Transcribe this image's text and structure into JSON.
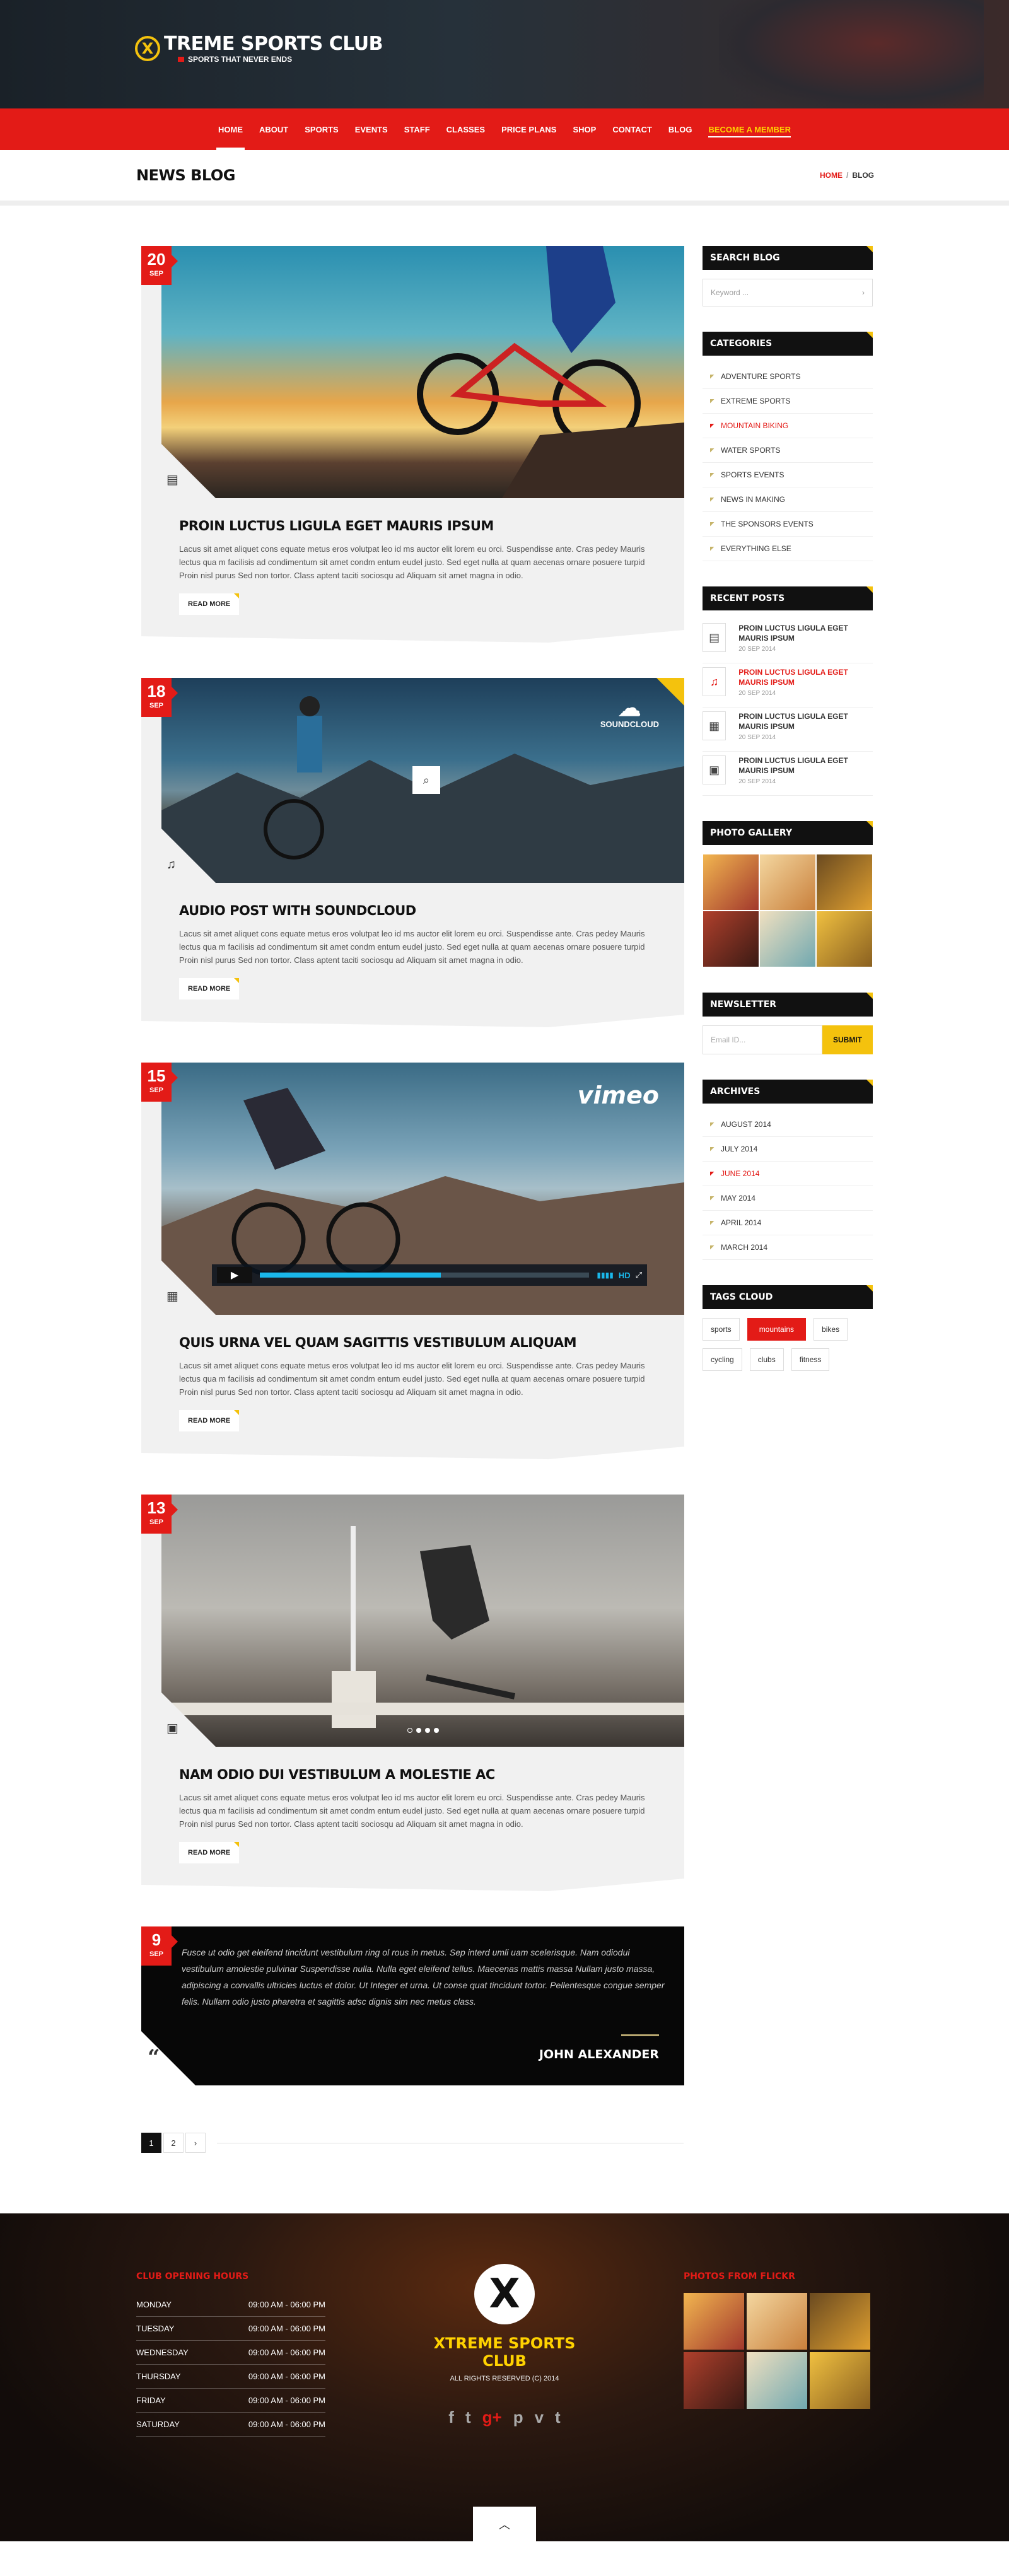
{
  "header": {
    "logo_mark": "X",
    "title": "TREME SPORTS CLUB",
    "tagline": "SPORTS THAT NEVER ENDS"
  },
  "nav": [
    "HOME",
    "ABOUT",
    "SPORTS",
    "EVENTS",
    "STAFF",
    "CLASSES",
    "PRICE PLANS",
    "SHOP",
    "CONTACT",
    "BLOG",
    "BECOME A MEMBER"
  ],
  "page": {
    "title": "NEWS BLOG",
    "breadcrumb": {
      "home": "HOME",
      "sep": "/",
      "current": "BLOG"
    }
  },
  "posts": [
    {
      "day": "20",
      "month": "SEP",
      "title": "PROIN LUCTUS LIGULA EGET MAURIS IPSUM",
      "text": "Lacus sit amet aliquet cons equate metus eros volutpat leo id ms auctor elit lorem eu orci. Suspendisse ante. Cras pedey Mauris lectus qua m facilisis ad condimentum sit amet condm entum eudel justo. Sed eget nulla at quam aecenas ornare posuere turpid Proin nisl purus Sed non tortor. Class aptent taciti sociosqu ad  Aliquam sit amet magna in odio.",
      "more": "READ MORE",
      "icon": "document-icon"
    },
    {
      "day": "18",
      "month": "SEP",
      "title": "AUDIO POST WITH SOUNDCLOUD",
      "text": "Lacus sit amet aliquet cons equate metus eros volutpat leo id ms auctor elit lorem eu orci. Suspendisse ante. Cras pedey Mauris lectus qua m facilisis ad condimentum sit amet condm entum eudel justo. Sed eget nulla at quam aecenas ornare posuere turpid Proin nisl purus Sed non tortor. Class aptent taciti sociosqu ad  Aliquam sit amet magna in odio.",
      "more": "READ MORE",
      "icon": "music-note-icon",
      "badge": "SOUNDCLOUD"
    },
    {
      "day": "15",
      "month": "SEP",
      "title": "QUIS URNA VEL QUAM SAGITTIS VESTIBULUM ALIQUAM",
      "text": "Lacus sit amet aliquet cons equate metus eros volutpat leo id ms auctor elit lorem eu orci. Suspendisse ante. Cras pedey Mauris lectus qua m facilisis ad condimentum sit amet condm entum eudel justo. Sed eget nulla at quam aecenas ornare posuere turpid Proin nisl purus Sed non tortor. Class aptent taciti sociosqu ad  Aliquam sit amet magna in odio.",
      "more": "READ MORE",
      "icon": "film-icon",
      "badge": "vimeo",
      "hd": "HD"
    },
    {
      "day": "13",
      "month": "SEP",
      "title": "NAM ODIO DUI VESTIBULUM A MOLESTIE AC",
      "text": "Lacus sit amet aliquet cons equate metus eros volutpat leo id ms auctor elit lorem eu orci. Suspendisse ante. Cras pedey Mauris lectus qua m facilisis ad condimentum sit amet condm entum eudel justo. Sed eget nulla at quam aecenas ornare posuere turpid Proin nisl purus Sed non tortor. Class aptent taciti sociosqu ad  Aliquam sit amet magna in odio.",
      "more": "READ MORE",
      "icon": "image-icon"
    }
  ],
  "quote": {
    "day": "9",
    "month": "SEP",
    "text": "Fusce ut odio get eleifend tincidunt vestibulum ring ol rous in metus. Sep interd umli uam scelerisque. Nam odiodui vestibulum amolestie pulvinar Suspendisse nulla. Nulla eget eleifend tellus. Maecenas mattis massa  Nullam justo massa, adipiscing a convallis ultricies luctus et dolor. Ut  Integer et urna. Ut conse quat tincidunt tortor. Pellentesque congue semper felis. Nullam odio justo pharetra et sagittis adsc dignis sim nec metus class.",
    "author": "JOHN ALEXANDER"
  },
  "pager": [
    "1",
    "2",
    "›"
  ],
  "sidebar": {
    "search_title": "SEARCH BLOG",
    "search_placeholder": "Keyword ...",
    "categories_title": "CATEGORIES",
    "categories": [
      "ADVENTURE SPORTS",
      "EXTREME SPORTS",
      "MOUNTAIN BIKING",
      "WATER SPORTS",
      "SPORTS EVENTS",
      "NEWS IN MAKING",
      "THE SPONSORS EVENTS",
      "EVERYTHING ELSE"
    ],
    "recent_title": "RECENT POSTS",
    "recent": [
      {
        "title": "PROIN LUCTUS LIGULA EGET MAURIS IPSUM",
        "date": "20 SEP 2014"
      },
      {
        "title": "PROIN LUCTUS LIGULA EGET MAURIS IPSUM",
        "date": "20 SEP 2014"
      },
      {
        "title": "PROIN LUCTUS LIGULA EGET MAURIS IPSUM",
        "date": "20 SEP 2014"
      },
      {
        "title": "PROIN LUCTUS LIGULA EGET MAURIS IPSUM",
        "date": "20 SEP 2014"
      }
    ],
    "gallery_title": "PHOTO GALLERY",
    "newsletter_title": "NEWSLETTER",
    "newsletter_placeholder": "Email ID...",
    "newsletter_button": "SUBMIT",
    "archives_title": "ARCHIVES",
    "archives": [
      "AUGUST 2014",
      "JULY 2014",
      "JUNE 2014",
      "MAY 2014",
      "APRIL 2014",
      "MARCH 2014"
    ],
    "tags_title": "TAGS CLOUD",
    "tags": [
      "sports",
      "mountains",
      "bikes",
      "cycling",
      "clubs",
      "fitness"
    ]
  },
  "footer": {
    "hours_title": "CLUB OPENING HOURS",
    "hours": [
      {
        "day": "MONDAY",
        "time": "09:00 AM - 06:00 PM"
      },
      {
        "day": "TUESDAY",
        "time": "09:00 AM - 06:00 PM"
      },
      {
        "day": "WEDNESDAY",
        "time": "09:00 AM - 06:00 PM"
      },
      {
        "day": "THURSDAY",
        "time": "09:00 AM - 06:00 PM"
      },
      {
        "day": "FRIDAY",
        "time": "09:00 AM - 06:00 PM"
      },
      {
        "day": "SATURDAY",
        "time": "09:00 AM - 06:00 PM"
      }
    ],
    "logo_mark": "X",
    "title": "XTREME SPORTS CLUB",
    "copyright": "ALL RIGHTS RESERVED (C) 2014",
    "social": [
      "f",
      "t",
      "g+",
      "p",
      "v",
      "t"
    ],
    "flickr_title": "PHOTOS FROM FLICKR"
  }
}
